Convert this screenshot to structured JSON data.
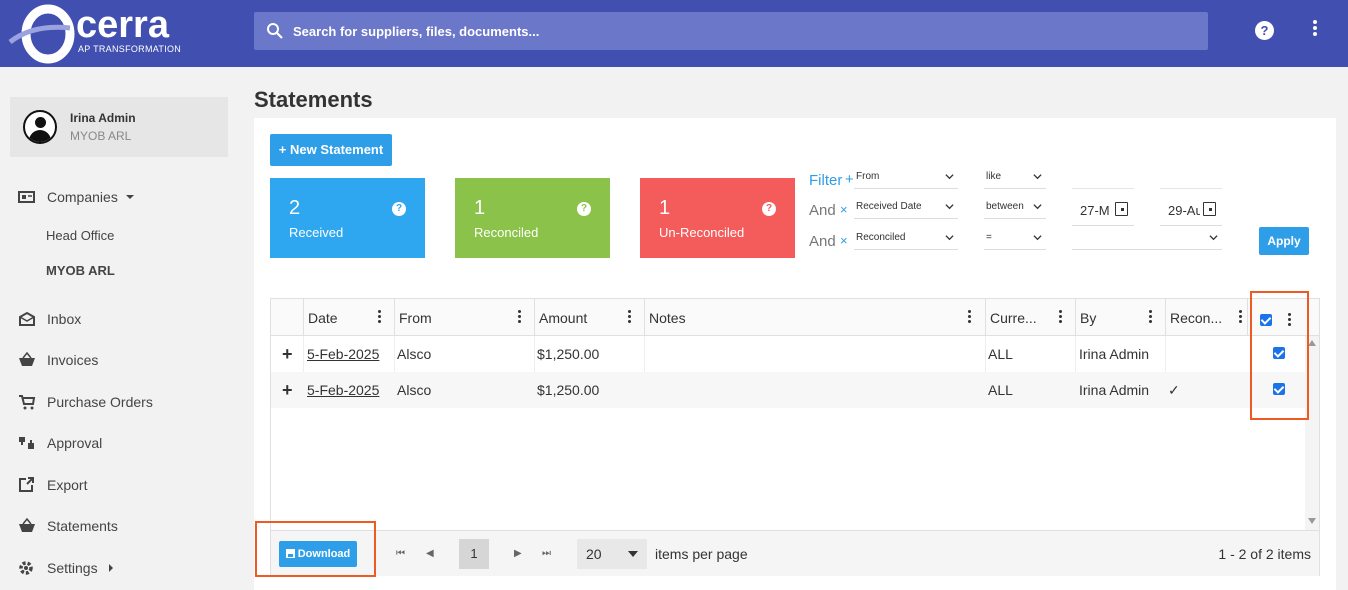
{
  "header": {
    "logo_text": "cerra",
    "logo_tagline": "AP TRANSFORMATION",
    "search_placeholder": "Search for suppliers, files, documents...",
    "help_label": "?"
  },
  "user": {
    "name": "Irina Admin",
    "org": "MYOB ARL"
  },
  "sidebar": {
    "companies": {
      "label": "Companies",
      "children": [
        "Head Office",
        "MYOB ARL"
      ]
    },
    "items": [
      {
        "label": "Inbox",
        "icon": "inbox-icon"
      },
      {
        "label": "Invoices",
        "icon": "basket-icon"
      },
      {
        "label": "Purchase Orders",
        "icon": "cart-icon"
      },
      {
        "label": "Approval",
        "icon": "thumbs-icon"
      },
      {
        "label": "Export",
        "icon": "export-icon"
      },
      {
        "label": "Statements",
        "icon": "basket-icon"
      },
      {
        "label": "Settings",
        "icon": "gear-icon"
      }
    ]
  },
  "page": {
    "title": "Statements",
    "new_button": "+ New Statement"
  },
  "cards": [
    {
      "count": "2",
      "label": "Received",
      "color": "#2ea7f0"
    },
    {
      "count": "1",
      "label": "Reconciled",
      "color": "#8bc34a"
    },
    {
      "count": "1",
      "label": "Un-Reconciled",
      "color": "#f45b5b"
    }
  ],
  "filter": {
    "title": "Filter",
    "plus": "+",
    "conjunction": "And",
    "remove": "×",
    "rows": [
      {
        "field": "From",
        "operator": "like",
        "value1": "",
        "value2": ""
      },
      {
        "field": "Received Date",
        "operator": "between",
        "value1": "27-M",
        "value2": "29-Au"
      },
      {
        "field": "Reconciled",
        "operator": "=",
        "value1": "",
        "value2": ""
      }
    ],
    "apply_label": "Apply"
  },
  "grid": {
    "columns": [
      "Date",
      "From",
      "Amount",
      "Notes",
      "Curre...",
      "By",
      "Recon..."
    ],
    "header_checkbox_checked": true,
    "rows": [
      {
        "date": "5-Feb-2025",
        "from": "Alsco",
        "amount": "$1,250.00",
        "notes": "",
        "currency": "ALL",
        "by": "Irina Admin",
        "reconciled": "",
        "checked": true
      },
      {
        "date": "5-Feb-2025",
        "from": "Alsco",
        "amount": "$1,250.00",
        "notes": "",
        "currency": "ALL",
        "by": "Irina Admin",
        "reconciled": "✓",
        "checked": true
      }
    ],
    "expand_symbol": "+"
  },
  "pager": {
    "download_label": "Download",
    "current_page": "1",
    "page_size": "20",
    "items_per_page_label": "items per page",
    "info": "1 - 2 of 2 items"
  },
  "colors": {
    "header": "#4150b0",
    "accent": "#2f9ee8",
    "highlight": "#ee5a24"
  }
}
